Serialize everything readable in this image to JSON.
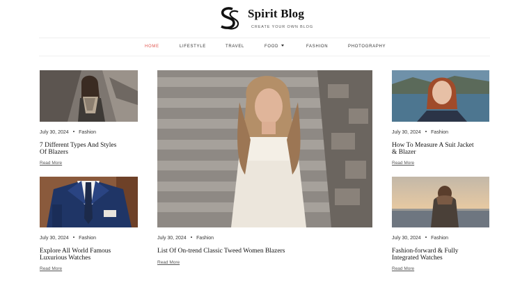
{
  "brand": {
    "logo_icon": "ss-monogram-icon",
    "title": "Spirit Blog",
    "tagline": "CREATE YOUR OWN BLOG"
  },
  "nav": {
    "items": [
      {
        "label": "HOME",
        "active": true
      },
      {
        "label": "LIFESTYLE",
        "active": false
      },
      {
        "label": "TRAVEL",
        "active": false
      },
      {
        "label": "FOOD",
        "active": false,
        "dropdown_icon": "caret-down-icon"
      },
      {
        "label": "FASHION",
        "active": false
      },
      {
        "label": "PHOTOGRAPHY",
        "active": false
      }
    ]
  },
  "colors": {
    "accent": "#e0554f",
    "text": "#222222",
    "muted": "#555555"
  },
  "posts": [
    {
      "date": "July 30, 2024",
      "category": "Fashion",
      "title_line1": "7 Different Types And Styles",
      "title_line2": "Of Blazers",
      "read_more": "Read More",
      "image": "woman-in-scarf-photo"
    },
    {
      "date": "July 30, 2024",
      "category": "Fashion",
      "title_line1": "Explore All World Famous",
      "title_line2": "Luxurious Watches",
      "read_more": "Read More",
      "image": "man-in-suit-photo"
    },
    {
      "date": "July 30, 2024",
      "category": "Fashion",
      "title_line1": "List Of On-trend Classic Tweed Women Blazers",
      "title_line2": "",
      "read_more": "Read More",
      "image": "woman-on-steps-photo"
    },
    {
      "date": "July 30, 2024",
      "category": "Fashion",
      "title_line1": "How To Measure A Suit Jacket",
      "title_line2": "& Blazer",
      "read_more": "Read More",
      "image": "red-haired-woman-photo"
    },
    {
      "date": "July 30, 2024",
      "category": "Fashion",
      "title_line1": "Fashion-forward & Fully",
      "title_line2": "Integrated Watches",
      "read_more": "Read More",
      "image": "person-at-sea-photo"
    }
  ]
}
